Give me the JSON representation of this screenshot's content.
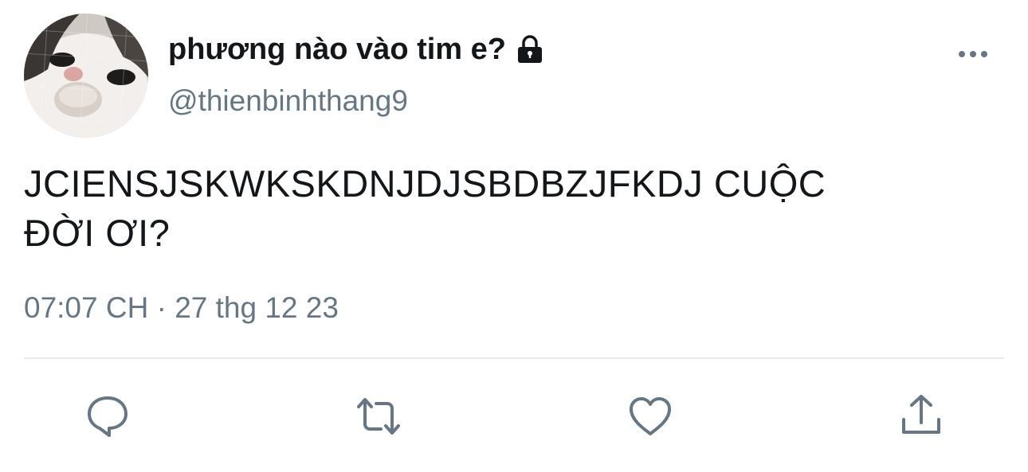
{
  "tweet": {
    "display_name": "phương nào vào tim e?",
    "handle": "@thienbinhthang9",
    "text": "JCIENSJSKWKSKDNJDJSBDBZJFKDJ CUỘC\nĐỜI ƠI?",
    "time": "07:07 CH",
    "separator": "·",
    "date": "27 thg 12 23",
    "protected": true
  },
  "icons": {
    "avatar": "cat-avatar",
    "lock": "lock-icon",
    "more": "more-icon",
    "reply": "reply-icon",
    "retweet": "retweet-icon",
    "like": "heart-icon",
    "share": "share-icon"
  },
  "colors": {
    "text": "#14171a",
    "secondary": "#657786",
    "divider": "#e6ecf0"
  }
}
